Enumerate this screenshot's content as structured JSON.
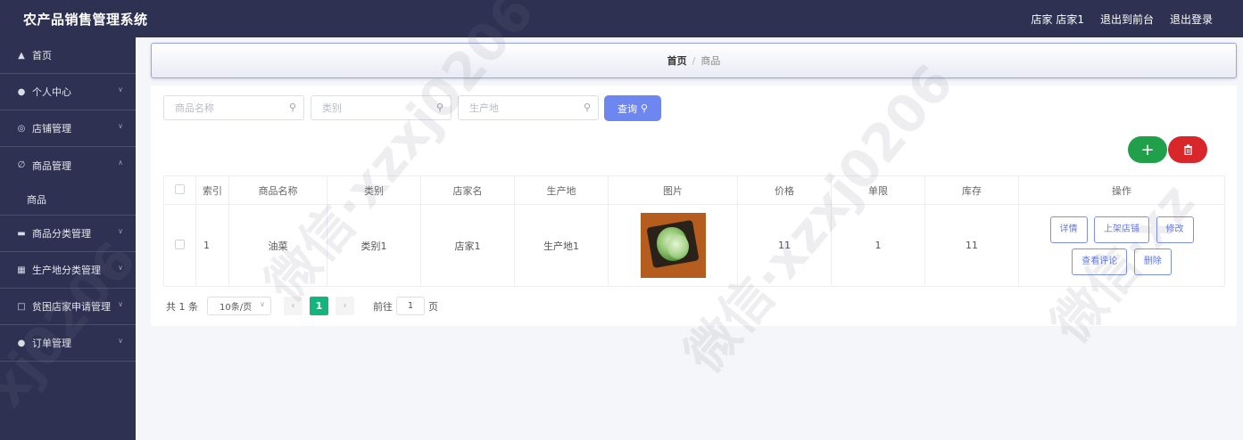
{
  "header": {
    "app_title": "农产品销售管理系统",
    "user_label": "店家 店家1",
    "back_front": "退出到前台",
    "logout": "退出登录"
  },
  "sidebar": {
    "items": [
      {
        "label": "首页",
        "icon": "home-icon"
      },
      {
        "label": "个人中心",
        "icon": "user-icon"
      },
      {
        "label": "店铺管理",
        "icon": "compass-icon"
      },
      {
        "label": "商品管理",
        "icon": "bell-off-icon",
        "expanded": true,
        "children": [
          "商品"
        ]
      },
      {
        "label": "商品分类管理",
        "icon": "monitor-icon"
      },
      {
        "label": "生产地分类管理",
        "icon": "grid-icon"
      },
      {
        "label": "贫困店家申请管理",
        "icon": "message-icon"
      },
      {
        "label": "订单管理",
        "icon": "user-icon"
      }
    ]
  },
  "breadcrumb": {
    "home": "首页",
    "separator": "/",
    "current": "商品"
  },
  "search": {
    "name_placeholder": "商品名称",
    "category_placeholder": "类别",
    "origin_placeholder": "生产地",
    "query_label": "查询"
  },
  "actions": {
    "add_label": "+",
    "delete_icon": "trash-icon"
  },
  "table": {
    "headers": [
      "",
      "索引",
      "商品名称",
      "类别",
      "店家名",
      "生产地",
      "图片",
      "价格",
      "单限",
      "库存",
      "操作"
    ],
    "rows": [
      {
        "index": "1",
        "name": "油菜",
        "category": "类别1",
        "shop": "店家1",
        "origin": "生产地1",
        "image": "bok-choy-photo",
        "price": "11",
        "limit": "1",
        "stock": "11",
        "ops": [
          "详情",
          "上架店铺",
          "修改",
          "查看评论",
          "删除"
        ]
      }
    ]
  },
  "pager": {
    "total": "共 1 条",
    "page_size": "10条/页",
    "current_page": "1",
    "goto_label": "前往",
    "goto_value": "1",
    "page_unit": "页"
  },
  "colors": {
    "nav_bg": "#2e3152",
    "primary": "#6d86f0",
    "success": "#20a04a",
    "danger": "#d9262a",
    "active_page": "#14b57d"
  }
}
